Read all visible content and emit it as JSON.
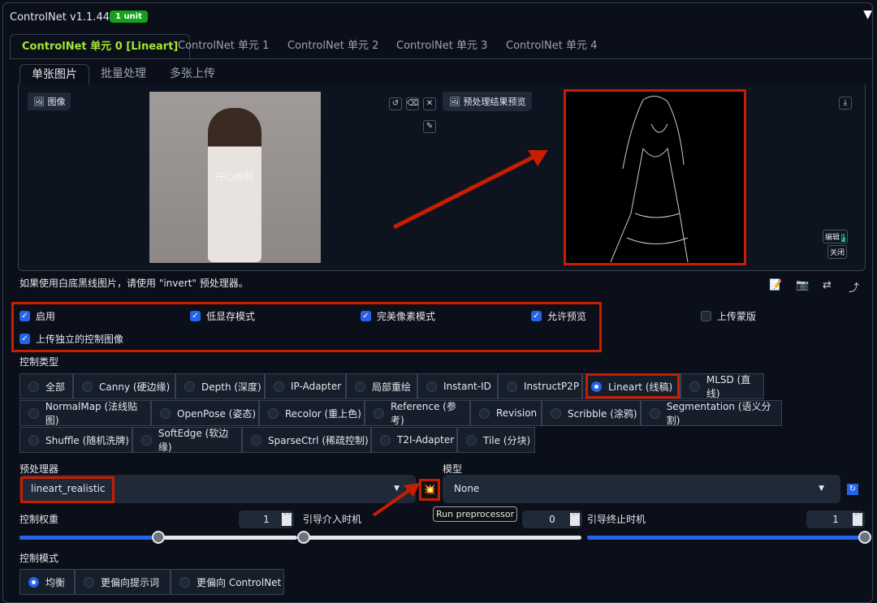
{
  "header": {
    "title": "ControlNet v1.1.445",
    "badge": "1 unit"
  },
  "unit_tabs": [
    "ControlNet 单元 0 [Lineart]",
    "ControlNet 单元 1",
    "ControlNet 单元 2",
    "ControlNet 单元 3",
    "ControlNet 单元 4"
  ],
  "image_tabs": [
    "单张图片",
    "批量处理",
    "多张上传"
  ],
  "image_panel": {
    "image_label": "图像",
    "preview_label": "预处理结果预览",
    "watermark": "开心绘制",
    "edit": "编辑",
    "close": "关闭"
  },
  "hint": "如果使用白底黑线图片，请使用 \"invert\" 预处理器。",
  "checkboxes": [
    {
      "label": "启用",
      "checked": true
    },
    {
      "label": "低显存模式",
      "checked": true
    },
    {
      "label": "完美像素模式",
      "checked": true
    },
    {
      "label": "允许预览",
      "checked": true
    },
    {
      "label": "上传蒙版",
      "checked": false
    },
    {
      "label": "上传独立的控制图像",
      "checked": true
    }
  ],
  "control_type": {
    "label": "控制类型",
    "options": [
      "全部",
      "Canny (硬边缘)",
      "Depth (深度)",
      "IP-Adapter",
      "局部重绘",
      "Instant-ID",
      "InstructP2P",
      "Lineart (线稿)",
      "MLSD (直线)",
      "NormalMap (法线贴图)",
      "OpenPose (姿态)",
      "Recolor (重上色)",
      "Reference (参考)",
      "Revision",
      "Scribble (涂鸦)",
      "Segmentation (语义分割)",
      "Shuffle (随机洗牌)",
      "SoftEdge (软边缘)",
      "SparseCtrl (稀疏控制)",
      "T2I-Adapter",
      "Tile (分块)"
    ],
    "selected": "Lineart (线稿)"
  },
  "preprocessor": {
    "label": "预处理器",
    "value": "lineart_realistic"
  },
  "model": {
    "label": "模型",
    "value": "None"
  },
  "tooltip": "Run preprocessor",
  "sliders": {
    "weight": {
      "label": "控制权重",
      "value": "1",
      "fraction": 0.5
    },
    "start": {
      "label": "引导介入时机",
      "value": "0",
      "fraction": 0
    },
    "end": {
      "label": "引导终止时机",
      "value": "1",
      "fraction": 1
    }
  },
  "control_mode": {
    "label": "控制模式",
    "options": [
      "均衡",
      "更偏向提示词",
      "更偏向 ControlNet"
    ],
    "selected": "均衡"
  },
  "colors": {
    "accent": "#2563eb",
    "highlight": "#c81e00",
    "tab_active": "#a3e635"
  }
}
